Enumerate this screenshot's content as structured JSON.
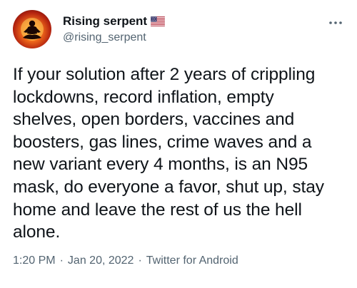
{
  "author": {
    "display_name": "Rising serpent",
    "handle": "@rising_serpent",
    "badge_icon": "us-flag-icon",
    "avatar_icon": "meditating-figure-icon"
  },
  "more_menu_icon": "more-icon",
  "tweet": {
    "text": "If your solution after 2 years of crippling\nlockdowns, record inflation, empty\nshelves, open borders, vaccines and\nboosters, gas lines, crime waves and a\nnew variant every 4 months, is an N95\nmask, do everyone a favor, shut up, stay\nhome and leave the rest of us the hell\nalone."
  },
  "meta": {
    "time": "1:20 PM",
    "separator": "·",
    "date": "Jan 20, 2022",
    "source": "Twitter for Android"
  },
  "colors": {
    "text_primary": "#0f1419",
    "text_secondary": "#536471",
    "background": "#ffffff"
  }
}
